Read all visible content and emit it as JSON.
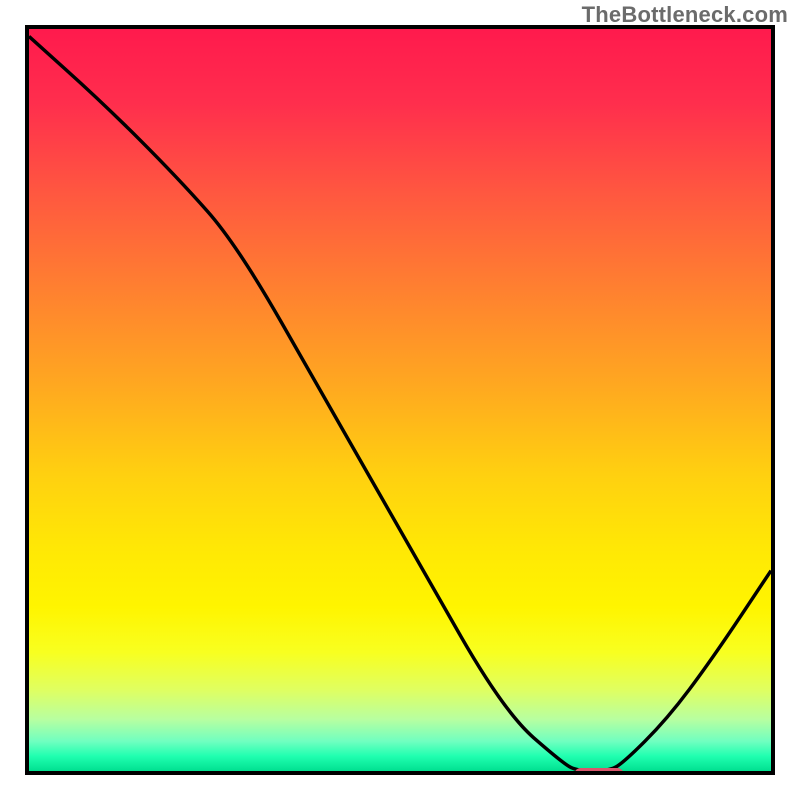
{
  "watermark": "TheBottleneck.com",
  "chart_data": {
    "type": "line",
    "title": "",
    "xlabel": "",
    "ylabel": "",
    "xlim": [
      0,
      100
    ],
    "ylim": [
      0,
      100
    ],
    "grid": false,
    "legend": false,
    "series": [
      {
        "name": "curve",
        "x": [
          0,
          10,
          20,
          28,
          40,
          52,
          64,
          72,
          74,
          78,
          80,
          86,
          92,
          100
        ],
        "y": [
          99,
          90,
          80,
          71,
          50,
          29,
          8,
          1,
          0,
          0,
          1,
          7,
          15,
          27
        ]
      }
    ],
    "marker": {
      "name": "optimal-range",
      "x_center": 76,
      "y": 0,
      "color": "#d9566b"
    },
    "background_gradient": {
      "top": "#ff1a4d",
      "bottom": "#00e090"
    }
  }
}
